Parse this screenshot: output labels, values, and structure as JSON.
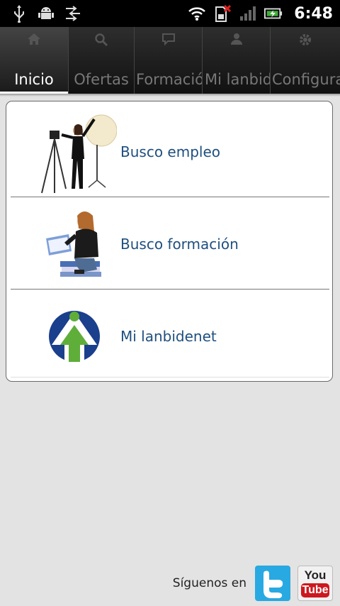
{
  "status_bar": {
    "time": "6:48",
    "icons_left": [
      "usb-icon",
      "android-debug-icon",
      "sync-icon"
    ],
    "icons_right": [
      "wifi-icon",
      "no-sim-icon",
      "signal-icon",
      "battery-charging-icon"
    ]
  },
  "tabs": [
    {
      "label": "Inicio",
      "icon": "home-icon",
      "active": true
    },
    {
      "label": "Ofertas",
      "icon": "search-icon",
      "active": false
    },
    {
      "label": "Formación",
      "icon": "chat-icon",
      "active": false
    },
    {
      "label": "Mi lanbidenet",
      "icon": "user-icon",
      "active": false
    },
    {
      "label": "Configuración",
      "icon": "gear-icon",
      "active": false
    }
  ],
  "menu": {
    "items": [
      {
        "label": "Busco empleo",
        "image": "photographer-image"
      },
      {
        "label": "Busco formación",
        "image": "student-reading-image"
      },
      {
        "label": "Mi lanbidenet",
        "image": "lanbide-logo"
      }
    ]
  },
  "footer": {
    "follow_text": "Síguenos en",
    "twitter_icon": "twitter-icon",
    "youtube_top": "You",
    "youtube_bottom": "Tube"
  },
  "colors": {
    "link": "#1f4f7f",
    "background": "#e3e3e3",
    "twitter": "#29a9e1",
    "youtube": "#cc181e",
    "logo_blue": "#1a3f8c",
    "logo_green": "#5fae3a"
  }
}
